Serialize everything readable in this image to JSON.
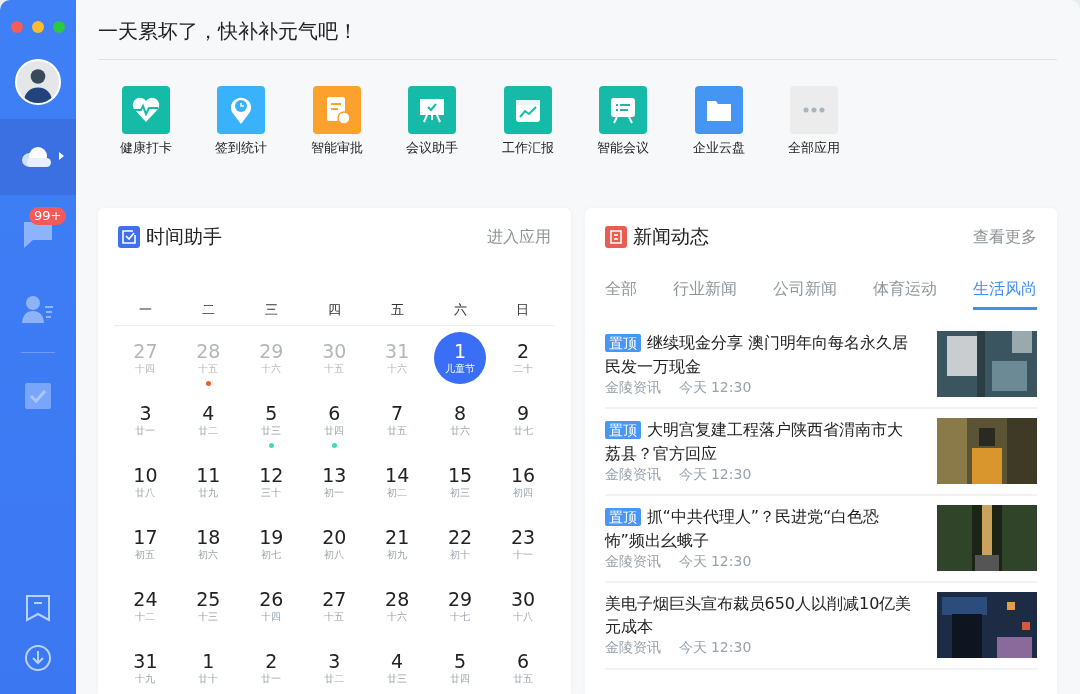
{
  "sidebar": {
    "nav": [
      {
        "kind": "cloud",
        "selected": true
      },
      {
        "kind": "chat",
        "badge": "99+",
        "selected": false
      },
      {
        "kind": "contacts",
        "selected": false
      },
      {
        "kind": "task",
        "selected": false
      }
    ]
  },
  "greeting": "一天累坏了，快补补元气吧！",
  "apps": [
    {
      "kind": "heart",
      "label": "健康打卡",
      "color": "#15bba6"
    },
    {
      "kind": "pin",
      "label": "签到统计",
      "color": "#3ab2fb"
    },
    {
      "kind": "doc",
      "label": "智能审批",
      "color": "#fca12b"
    },
    {
      "kind": "board",
      "label": "会议助手",
      "color": "#15bba6"
    },
    {
      "kind": "chart",
      "label": "工作汇报",
      "color": "#15bba6"
    },
    {
      "kind": "chat",
      "label": "智能会议",
      "color": "#15bba6"
    },
    {
      "kind": "folder",
      "label": "企业云盘",
      "color": "#4596f2"
    },
    {
      "kind": "more",
      "label": "全部应用",
      "color": "#ececec"
    }
  ],
  "calendar": {
    "title": "时间助手",
    "link": "进入应用",
    "weekdays": [
      "一",
      "二",
      "三",
      "四",
      "五",
      "六",
      "日"
    ],
    "weeks": [
      [
        {
          "day": "27",
          "lunar": "十四",
          "other_month": true,
          "selected": false
        },
        {
          "day": "28",
          "lunar": "十五",
          "other_month": true,
          "selected": false,
          "color": "#ef5b2a"
        },
        {
          "day": "29",
          "lunar": "十六",
          "other_month": true,
          "selected": false
        },
        {
          "day": "30",
          "lunar": "十五",
          "other_month": true,
          "selected": false
        },
        {
          "day": "31",
          "lunar": "十六",
          "other_month": true,
          "selected": false
        },
        {
          "day": "1",
          "lunar": "儿童节",
          "other_month": false,
          "selected": true
        },
        {
          "day": "2",
          "lunar": "二十",
          "other_month": false,
          "selected": false
        }
      ],
      [
        {
          "day": "3",
          "lunar": "廿一",
          "other_month": false,
          "selected": false
        },
        {
          "day": "4",
          "lunar": "廿二",
          "other_month": false,
          "selected": false
        },
        {
          "day": "5",
          "lunar": "廿三",
          "other_month": false,
          "selected": false,
          "color": "#3ddcb6"
        },
        {
          "day": "6",
          "lunar": "廿四",
          "other_month": false,
          "selected": false,
          "color": "#3ddcb6"
        },
        {
          "day": "7",
          "lunar": "廿五",
          "other_month": false,
          "selected": false
        },
        {
          "day": "8",
          "lunar": "廿六",
          "other_month": false,
          "selected": false
        },
        {
          "day": "9",
          "lunar": "廿七",
          "other_month": false,
          "selected": false
        }
      ],
      [
        {
          "day": "10",
          "lunar": "廿八",
          "other_month": false,
          "selected": false
        },
        {
          "day": "11",
          "lunar": "廿九",
          "other_month": false,
          "selected": false
        },
        {
          "day": "12",
          "lunar": "三十",
          "other_month": false,
          "selected": false
        },
        {
          "day": "13",
          "lunar": "初一",
          "other_month": false,
          "selected": false
        },
        {
          "day": "14",
          "lunar": "初二",
          "other_month": false,
          "selected": false
        },
        {
          "day": "15",
          "lunar": "初三",
          "other_month": false,
          "selected": false
        },
        {
          "day": "16",
          "lunar": "初四",
          "other_month": false,
          "selected": false
        }
      ],
      [
        {
          "day": "17",
          "lunar": "初五",
          "other_month": false,
          "selected": false
        },
        {
          "day": "18",
          "lunar": "初六",
          "other_month": false,
          "selected": false
        },
        {
          "day": "19",
          "lunar": "初七",
          "other_month": false,
          "selected": false
        },
        {
          "day": "20",
          "lunar": "初八",
          "other_month": false,
          "selected": false
        },
        {
          "day": "21",
          "lunar": "初九",
          "other_month": false,
          "selected": false
        },
        {
          "day": "22",
          "lunar": "初十",
          "other_month": false,
          "selected": false
        },
        {
          "day": "23",
          "lunar": "十一",
          "other_month": false,
          "selected": false
        }
      ],
      [
        {
          "day": "24",
          "lunar": "十二",
          "other_month": false,
          "selected": false
        },
        {
          "day": "25",
          "lunar": "十三",
          "other_month": false,
          "selected": false
        },
        {
          "day": "26",
          "lunar": "十四",
          "other_month": false,
          "selected": false
        },
        {
          "day": "27",
          "lunar": "十五",
          "other_month": false,
          "selected": false
        },
        {
          "day": "28",
          "lunar": "十六",
          "other_month": false,
          "selected": false
        },
        {
          "day": "29",
          "lunar": "十七",
          "other_month": false,
          "selected": false
        },
        {
          "day": "30",
          "lunar": "十八",
          "other_month": false,
          "selected": false
        }
      ],
      [
        {
          "day": "31",
          "lunar": "十九",
          "other_month": false,
          "selected": false
        },
        {
          "day": "1",
          "lunar": "廿十",
          "other_month": false,
          "selected": false
        },
        {
          "day": "2",
          "lunar": "廿一",
          "other_month": false,
          "selected": false
        },
        {
          "day": "3",
          "lunar": "廿二",
          "other_month": false,
          "selected": false
        },
        {
          "day": "4",
          "lunar": "廿三",
          "other_month": false,
          "selected": false
        },
        {
          "day": "5",
          "lunar": "廿四",
          "other_month": false,
          "selected": false
        },
        {
          "day": "6",
          "lunar": "廿五",
          "other_month": false,
          "selected": false
        }
      ]
    ]
  },
  "news": {
    "title": "新闻动态",
    "link": "查看更多",
    "tabs": [
      {
        "label": "全部",
        "selected": false
      },
      {
        "label": "行业新闻",
        "selected": false
      },
      {
        "label": "公司新闻",
        "selected": false
      },
      {
        "label": "体育运动",
        "selected": false
      },
      {
        "label": "生活风尚",
        "selected": true
      }
    ],
    "items": [
      {
        "tag": "置顶",
        "title": "继续现金分享 澳门明年向每名永久居民发一万现金",
        "source": "金陵资讯",
        "time": "今天 12:30"
      },
      {
        "tag": "置顶",
        "title": "大明宫复建工程落户陕西省渭南市大荔县？官方回应",
        "source": "金陵资讯",
        "time": "今天 12:30"
      },
      {
        "tag": "置顶",
        "title": "抓“中共代理人”？民进党“白色恐怖”频出幺蛾子",
        "source": "金陵资讯",
        "time": "今天 12:30"
      },
      {
        "title": "美电子烟巨头宣布裁员650人以削减10亿美元成本",
        "source": "金陵资讯",
        "time": "今天 12:30"
      }
    ]
  }
}
